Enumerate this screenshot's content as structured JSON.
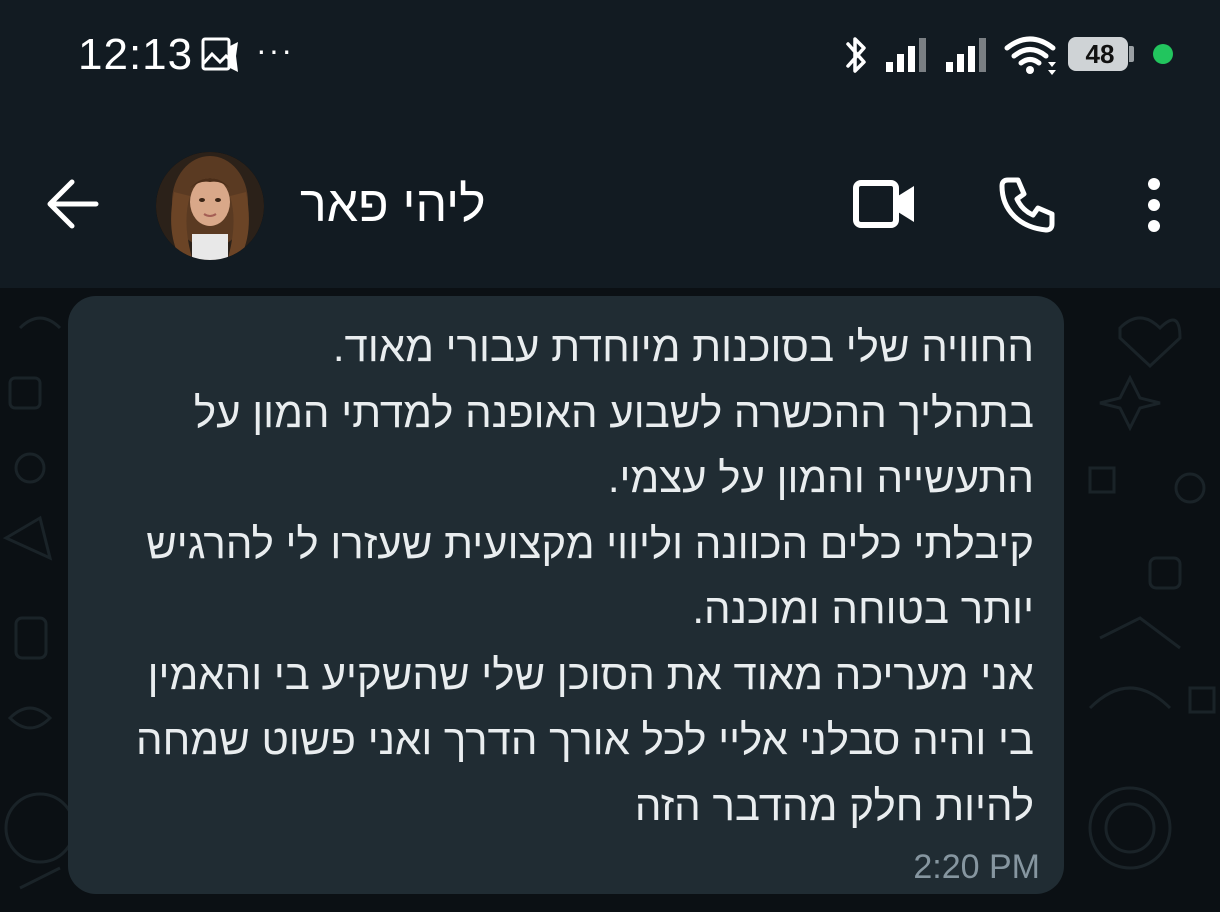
{
  "status_bar": {
    "time": "12:13",
    "more_notifications": "···",
    "battery_level": "48",
    "icons": [
      "gallery-notification-icon",
      "bluetooth-icon",
      "signal-icon",
      "signal-icon",
      "wifi-icon",
      "battery-icon",
      "dot-icon"
    ]
  },
  "header": {
    "contact_name": "ליהי פאר",
    "icons": [
      "back-arrow-icon",
      "video-call-icon",
      "phone-icon",
      "more-options-icon"
    ]
  },
  "message": {
    "text": "החוויה שלי בסוכנות מיוחדת עבורי מאוד.\nבתהליך ההכשרה לשבוע האופנה למדתי המון על התעשייה והמון על עצמי.\nקיבלתי כלים הכוונה וליווי מקצועית שעזרו לי להרגיש יותר בטוחה ומוכנה.\nאני מעריכה מאוד את הסוכן שלי שהשקיע בי והאמין בי והיה סבלני אליי לכל אורך הדרך ואני פשוט שמחה להיות חלק מהדבר הזה",
    "time": "2:20 PM"
  },
  "colors": {
    "header_bg": "#121b22",
    "chat_bg": "#0b1014",
    "bubble_bg": "#202c33",
    "online_dot": "#22c55e"
  }
}
